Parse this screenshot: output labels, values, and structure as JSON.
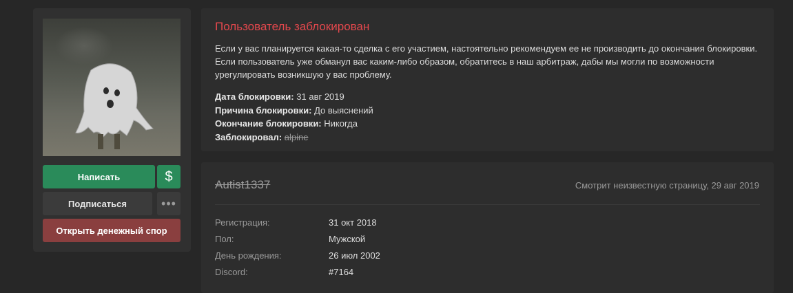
{
  "sidebar": {
    "avatar_icon": "ghost-avatar",
    "write_label": "Написать",
    "money_label": "$",
    "subscribe_label": "Подписаться",
    "more_label": "•••",
    "dispute_label": "Открыть денежный спор",
    "colors": {
      "green": "#2a8b5a",
      "red": "#8a3f3f",
      "gray": "#3b3b3b"
    }
  },
  "ban": {
    "title": "Пользователь заблокирован",
    "text": "Если у вас планируется какая-то сделка с его участием, настоятельно рекомендуем ее не производить до окончания блокировки. Если пользователь уже обманул вас каким-либо образом, обратитесь в наш арбитраж, дабы мы могли по возможности урегулировать возникшую у вас проблему.",
    "date_label": "Дата блокировки:",
    "date_value": "31 авг 2019",
    "reason_label": "Причина блокировки:",
    "reason_value": "До выяснений",
    "end_label": "Окончание блокировки:",
    "end_value": "Никогда",
    "by_label": "Заблокировал:",
    "by_value": "alpine",
    "title_color": "#e5484d"
  },
  "profile": {
    "username": "Autist1337",
    "last_seen": "Смотрит неизвестную страницу, 29 авг 2019",
    "fields": [
      {
        "label": "Регистрация:",
        "value": "31 окт 2018"
      },
      {
        "label": "Пол:",
        "value": "Мужской"
      },
      {
        "label": "День рождения:",
        "value": "26 июл 2002"
      },
      {
        "label": "Discord:",
        "value": "#7164"
      }
    ]
  }
}
